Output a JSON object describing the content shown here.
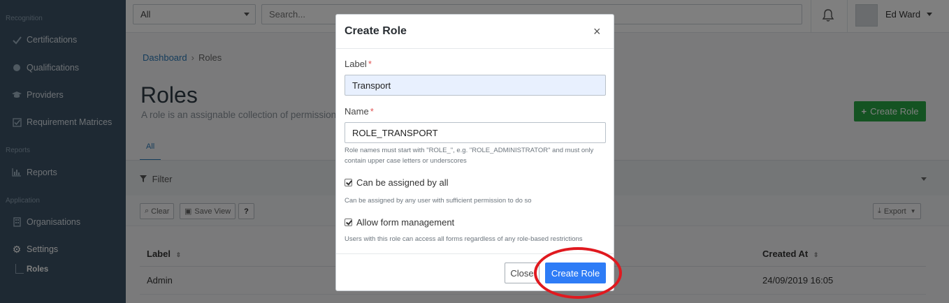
{
  "sidebar": {
    "sections": {
      "recognition": "Recognition",
      "reports": "Reports",
      "application": "Application"
    },
    "items": [
      {
        "label": "Certifications",
        "icon": "check-icon"
      },
      {
        "label": "Qualifications",
        "icon": "circle-icon"
      },
      {
        "label": "Providers",
        "icon": "graduation-cap-icon"
      },
      {
        "label": "Requirement Matrices",
        "icon": "checkbox-icon"
      },
      {
        "label": "Reports",
        "icon": "bar-chart-icon"
      },
      {
        "label": "Organisations",
        "icon": "building-icon"
      },
      {
        "label": "Settings",
        "icon": "gear-icon"
      }
    ],
    "sub_items": [
      {
        "label": "Roles"
      }
    ]
  },
  "topbar": {
    "scope_value": "All",
    "search_placeholder": "Search...",
    "user_name": "Ed Ward"
  },
  "page": {
    "breadcrumb_home": "Dashboard",
    "breadcrumb_sep": "›",
    "breadcrumb_current": "Roles",
    "title": "Roles",
    "subtitle": "A role is an assignable collection of permissions",
    "create_button": "Create Role",
    "tab_all": "All",
    "filter_label": "Filter",
    "clear_button": "Clear",
    "save_view_button": "Save View",
    "help_button": "?",
    "export_button": "Export",
    "table": {
      "headers": [
        "Label",
        "Created At"
      ],
      "rows": [
        {
          "label": "Admin",
          "created_at": "24/09/2019 16:05"
        }
      ]
    }
  },
  "modal": {
    "title": "Create Role",
    "close_symbol": "×",
    "label_field": {
      "label": "Label",
      "required_marker": "*",
      "value": "Transport"
    },
    "name_field": {
      "label": "Name",
      "required_marker": "*",
      "value": "ROLE_TRANSPORT",
      "help": "Role names must start with \"ROLE_\", e.g. \"ROLE_ADMINISTRATOR\" and must only contain upper case letters or underscores"
    },
    "assignable": {
      "label": "Can be assigned by all",
      "checked": true,
      "help": "Can be assigned by any user with sufficient permission to do so"
    },
    "form_management": {
      "label": "Allow form management",
      "checked": true,
      "help": "Users with this role can access all forms regardless of any role-based restrictions"
    },
    "close_button": "Close",
    "create_button": "Create Role"
  },
  "colors": {
    "sidebar_bg": "#3d5366",
    "primary": "#2e7cf6",
    "success": "#28a745",
    "highlight": "#e0191f"
  }
}
